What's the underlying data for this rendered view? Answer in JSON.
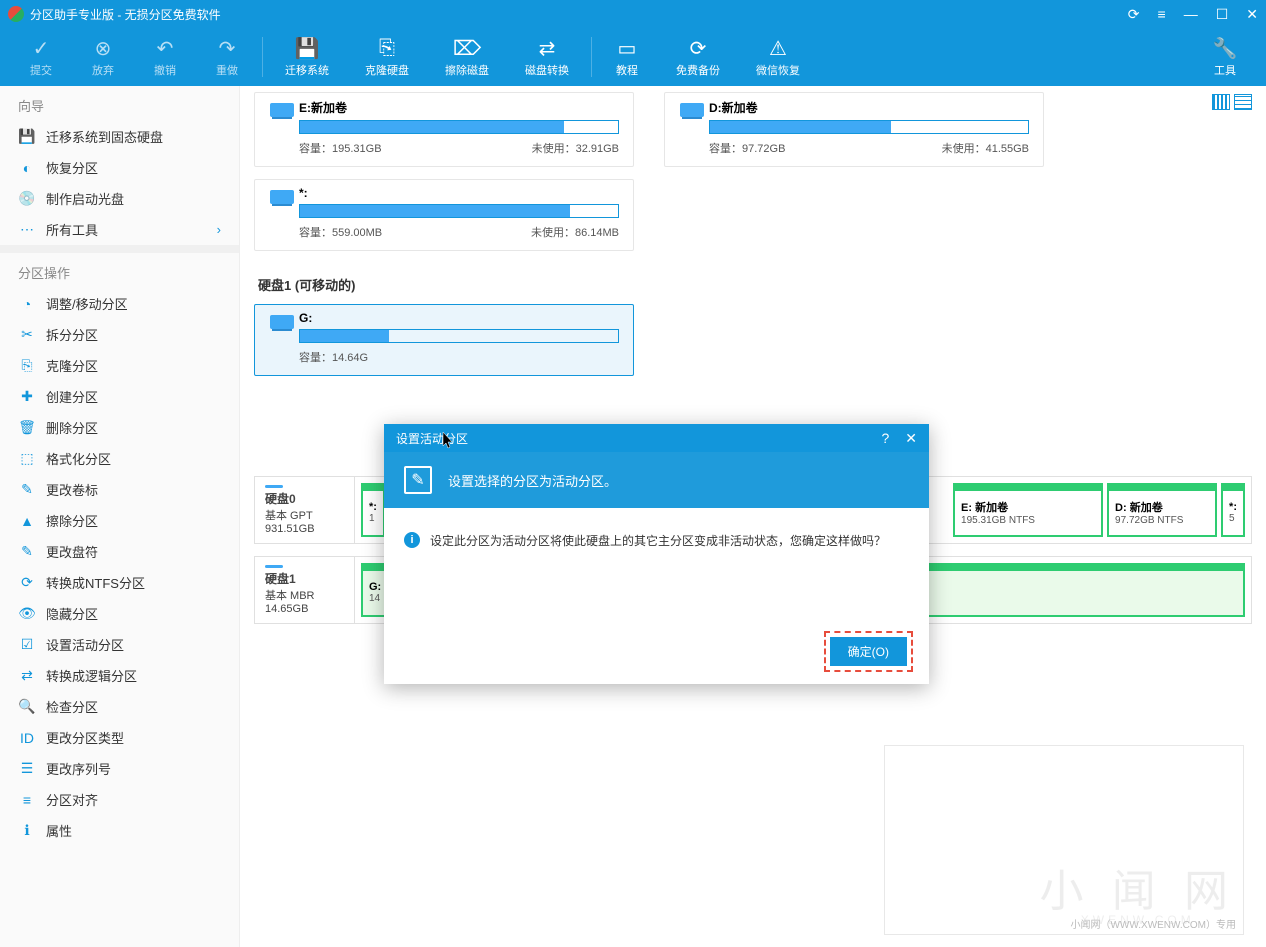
{
  "title": "分区助手专业版 - 无损分区免费软件",
  "titlebar_controls": [
    "⟳",
    "≡",
    "—",
    "□",
    "✕"
  ],
  "toolbar": [
    {
      "icon": "✓",
      "label": "提交",
      "active": false
    },
    {
      "icon": "⊗",
      "label": "放弃",
      "active": false
    },
    {
      "icon": "↶",
      "label": "撤销",
      "active": false
    },
    {
      "icon": "↷",
      "label": "重做",
      "active": false
    },
    {
      "sep": true
    },
    {
      "icon": "💾",
      "label": "迁移系统",
      "active": true
    },
    {
      "icon": "⎘",
      "label": "克隆硬盘",
      "active": true
    },
    {
      "icon": "⌦",
      "label": "擦除磁盘",
      "active": true
    },
    {
      "icon": "⇄",
      "label": "磁盘转换",
      "active": true
    },
    {
      "sep": true
    },
    {
      "icon": "▭",
      "label": "教程",
      "active": true
    },
    {
      "icon": "⟳",
      "label": "免费备份",
      "active": true
    },
    {
      "icon": "⚠",
      "label": "微信恢复",
      "active": true
    },
    {
      "spacer": true
    },
    {
      "icon": "🔧",
      "label": "工具",
      "active": true
    }
  ],
  "sidebar": {
    "wizard_header": "向导",
    "wizard_items": [
      {
        "icon": "💾",
        "label": "迁移系统到固态硬盘"
      },
      {
        "icon": "◐",
        "label": "恢复分区"
      },
      {
        "icon": "💿",
        "label": "制作启动光盘"
      },
      {
        "icon": "⋯",
        "label": "所有工具",
        "chevron": true
      }
    ],
    "ops_header": "分区操作",
    "ops_items": [
      {
        "icon": "◔",
        "label": "调整/移动分区"
      },
      {
        "icon": "✂",
        "label": "拆分分区"
      },
      {
        "icon": "⎘",
        "label": "克隆分区"
      },
      {
        "icon": "✚",
        "label": "创建分区"
      },
      {
        "icon": "🗑",
        "label": "删除分区"
      },
      {
        "icon": "⬚",
        "label": "格式化分区"
      },
      {
        "icon": "✎",
        "label": "更改卷标"
      },
      {
        "icon": "▲",
        "label": "擦除分区"
      },
      {
        "icon": "✎",
        "label": "更改盘符"
      },
      {
        "icon": "⟳",
        "label": "转换成NTFS分区"
      },
      {
        "icon": "👁",
        "label": "隐藏分区"
      },
      {
        "icon": "☑",
        "label": "设置活动分区"
      },
      {
        "icon": "⇄",
        "label": "转换成逻辑分区"
      },
      {
        "icon": "🔍",
        "label": "检查分区"
      },
      {
        "icon": "ID",
        "label": "更改分区类型"
      },
      {
        "icon": "☰",
        "label": "更改序列号"
      },
      {
        "icon": "≡",
        "label": "分区对齐"
      },
      {
        "icon": "ℹ",
        "label": "属性"
      }
    ]
  },
  "partitions_top": [
    {
      "name": "E:新加卷",
      "capacity": "容量：195.31GB",
      "unused": "未使用：32.91GB",
      "fill": 83
    },
    {
      "name": "D:新加卷",
      "capacity": "容量：97.72GB",
      "unused": "未使用：41.55GB",
      "fill": 57
    }
  ],
  "partition_star": {
    "name": "*:",
    "capacity": "容量：559.00MB",
    "unused": "未使用：86.14MB",
    "fill": 85
  },
  "disk1_header": "硬盘1 (可移动的)",
  "partition_g": {
    "name": "G:",
    "capacity": "容量：14.64G",
    "fill": 28
  },
  "diskrows": [
    {
      "ico": true,
      "name": "硬盘0",
      "type": "基本 GPT",
      "size": "931.51GB",
      "parts": [
        {
          "label": "*:",
          "size": "1",
          "w": 4
        },
        {
          "label": "E: 新加卷",
          "size": "195.31GB NTFS",
          "w": 16
        },
        {
          "label": "D: 新加卷",
          "size": "97.72GB NTFS",
          "w": 12
        },
        {
          "label": "*:",
          "size": "5",
          "w": 4
        }
      ]
    },
    {
      "ico": true,
      "name": "硬盘1",
      "type": "基本 MBR",
      "size": "14.65GB",
      "parts": [
        {
          "label": "G:",
          "size": "14",
          "w": 88,
          "selected": true
        }
      ]
    }
  ],
  "dialog": {
    "title": "设置活动分区",
    "banner": "设置选择的分区为活动分区。",
    "message": "设定此分区为活动分区将使此硬盘上的其它主分区变成非活动状态，您确定这样做吗？",
    "ok": "确定(O)"
  },
  "watermark": {
    "big": "小 闻 网",
    "sub": "XWENW.COM",
    "foot": "小闻网（WWW.XWENW.COM）专用"
  }
}
